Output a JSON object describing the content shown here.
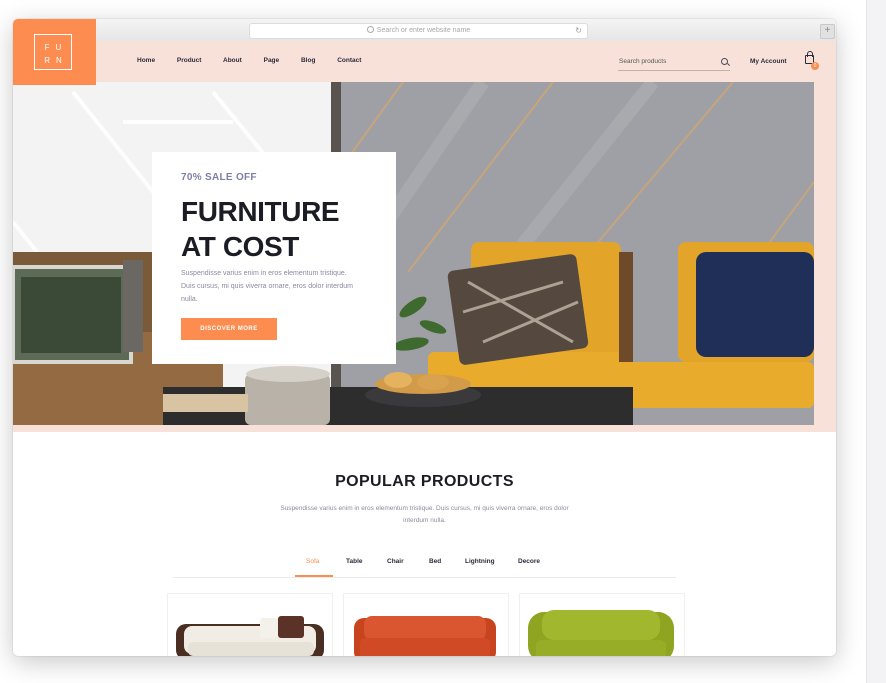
{
  "browser": {
    "url_placeholder": "Search or enter website name",
    "new_tab": "+"
  },
  "logo": {
    "line1": "FU",
    "line2": "RN"
  },
  "nav": {
    "items": [
      "Home",
      "Product",
      "About",
      "Page",
      "Blog",
      "Contact"
    ],
    "search_placeholder": "Search products",
    "account": "My Account",
    "cart_count": "0"
  },
  "hero": {
    "sale": "70% SALE OFF",
    "title_line1": "FURNITURE",
    "title_line2": "AT COST",
    "description": "Suspendisse varius enim in eros elementum tristique. Duis cursus, mi quis viverra ornare, eros dolor interdum nulla.",
    "cta": "DISCOVER MORE"
  },
  "popular": {
    "title": "POPULAR PRODUCTS",
    "description": "Suspendisse varius enim in eros elementum tristique. Duis cursus, mi quis viverra ornare, eros dolor interdum nulla.",
    "tabs": [
      "Sofa",
      "Table",
      "Chair",
      "Bed",
      "Lightning",
      "Decore"
    ],
    "active_tab": "Sofa"
  },
  "colors": {
    "accent": "#fc8c4f",
    "nav_bg": "#f7e1d9",
    "heading": "#1c1c24",
    "sale_text": "#7e7fa8"
  }
}
